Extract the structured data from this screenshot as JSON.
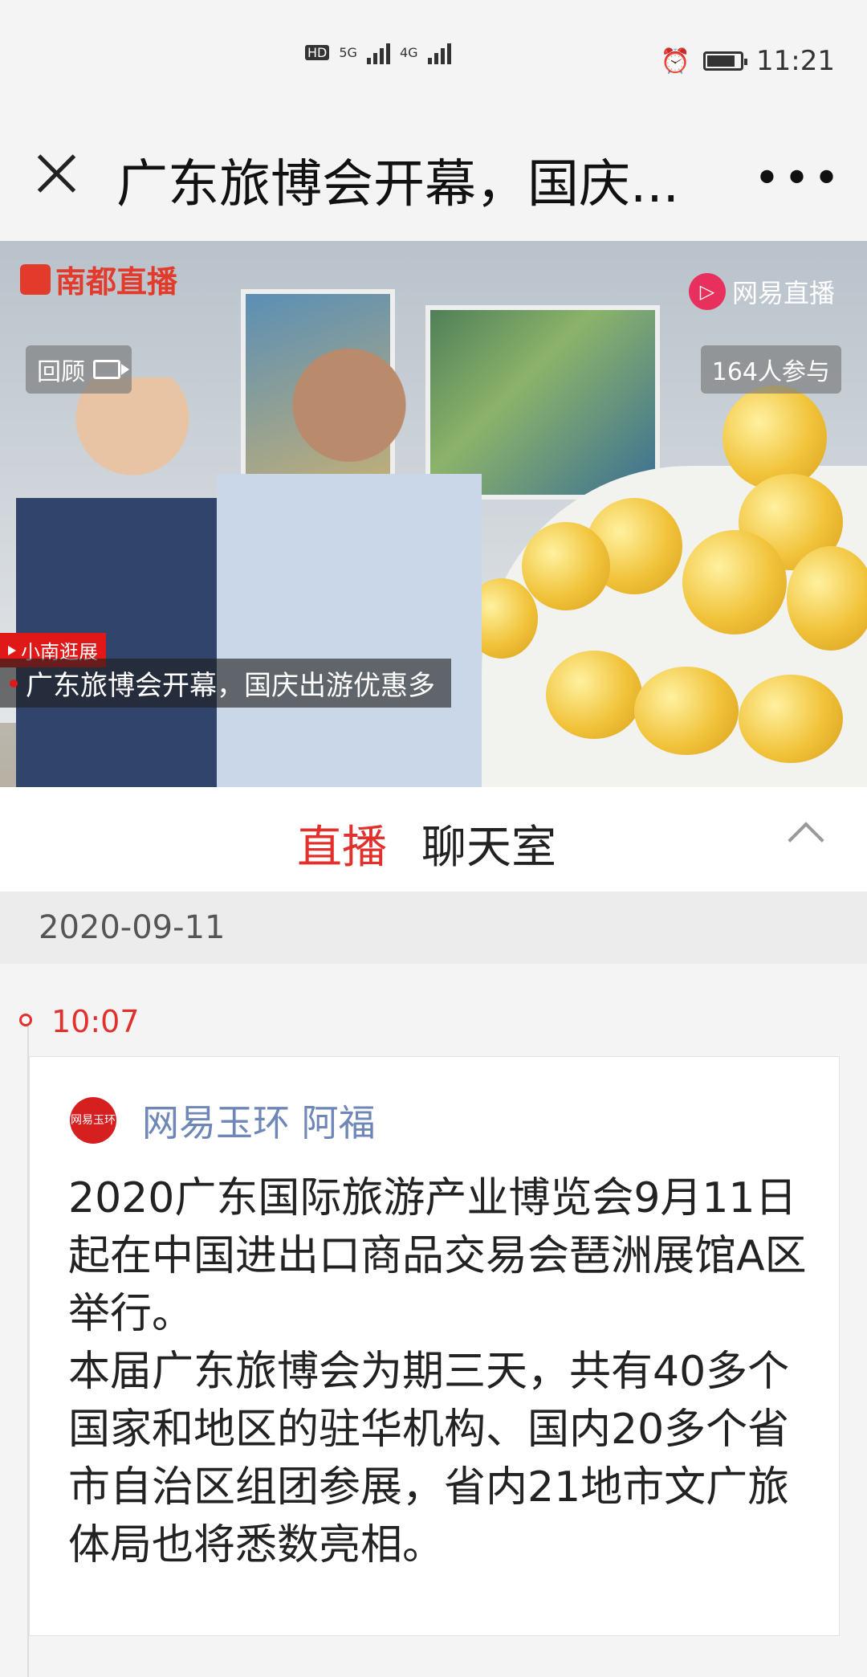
{
  "status_bar": {
    "hd1": "HD",
    "hd2": "HD",
    "net1": "5G",
    "net2": "4G",
    "time": "11:21",
    "icons": [
      "sim-hd-icon",
      "signal-icon",
      "alarm-icon",
      "battery-icon"
    ]
  },
  "header": {
    "title": "广东旅博会开幕，国庆...",
    "more_label": "•••"
  },
  "video": {
    "brand_left": "南都直播",
    "brand_right": "网易直播",
    "replay_label": "回顾",
    "viewers": "164人参与",
    "segment_tag": "小南逛展",
    "caption": "广东旅博会开幕，国庆出游优惠多"
  },
  "tabs": {
    "live": "直播",
    "chat": "聊天室"
  },
  "feed": {
    "date": "2020-09-11",
    "time": "10:07",
    "avatar_text": "网易玉环",
    "author": "网易玉环 阿福",
    "content": "2020广东国际旅游产业博览会9月11日起在中国进出口商品交易会琶洲展馆A区举行。\n本届广东旅博会为期三天，共有40多个国家和地区的驻华机构、国内20多个省市自治区组团参展，省内21地市文广旅体局也将悉数亮相。"
  },
  "colors": {
    "accent": "#e2312d",
    "author": "#6f86b8",
    "background": "#f4f4f4"
  }
}
